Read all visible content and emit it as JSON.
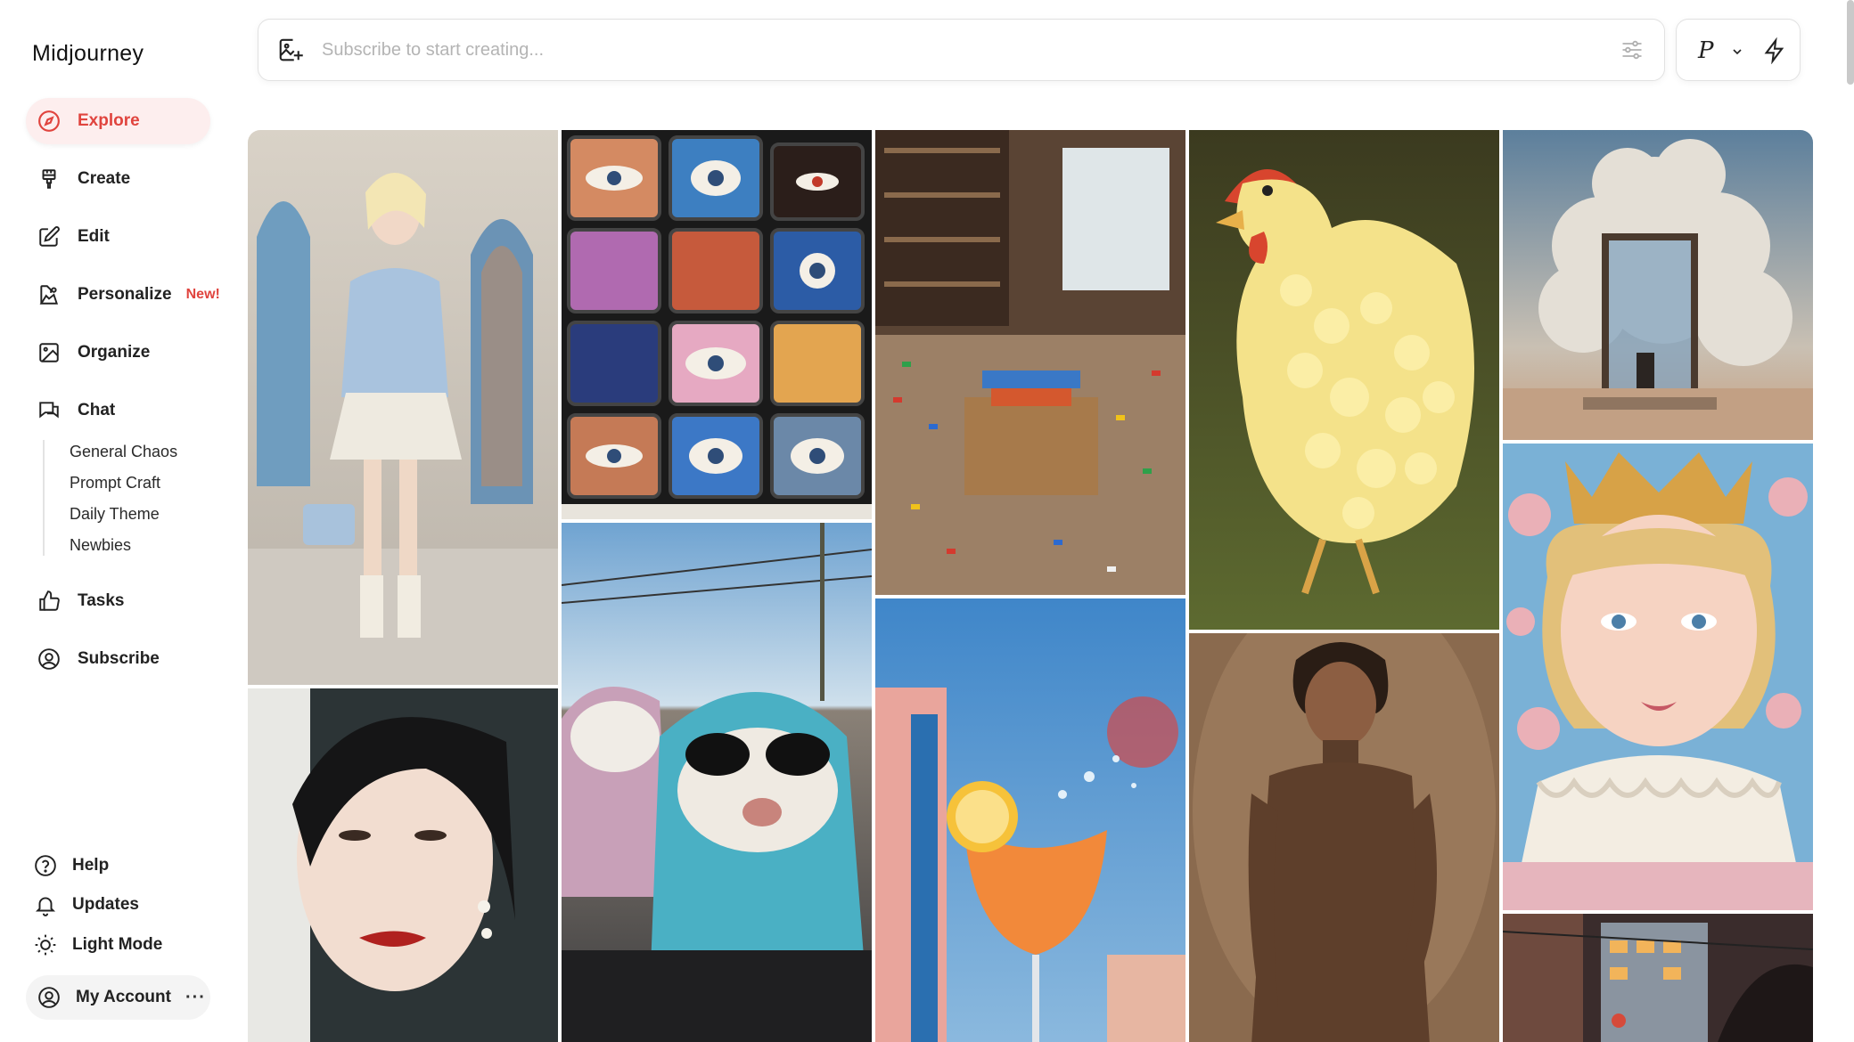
{
  "app": {
    "name": "Midjourney"
  },
  "nav": {
    "explore": "Explore",
    "create": "Create",
    "edit": "Edit",
    "personalize": "Personalize",
    "personalize_badge": "New!",
    "organize": "Organize",
    "chat": "Chat",
    "chat_channels": [
      "General Chaos",
      "Prompt Craft",
      "Daily Theme",
      "Newbies"
    ],
    "tasks": "Tasks",
    "subscribe": "Subscribe"
  },
  "footer_nav": {
    "help": "Help",
    "updates": "Updates",
    "light_mode": "Light Mode",
    "account": "My Account",
    "more": "···"
  },
  "prompt": {
    "placeholder": "Subscribe to start creating..."
  },
  "mode": {
    "letter": "P"
  },
  "colors": {
    "accent": "#e0443e",
    "active_bg": "#fdeeee"
  },
  "icons": [
    "compass-icon",
    "brush-icon",
    "edit-icon",
    "personalize-icon",
    "image-icon",
    "chat-icon",
    "thumbs-up-icon",
    "user-circle-icon",
    "help-icon",
    "bell-icon",
    "sun-icon",
    "image-add-icon",
    "sliders-icon",
    "chevron-down-icon",
    "bolt-icon"
  ],
  "gallery": {
    "items": [
      "girl-in-cathedral-pastel-outfit",
      "collage-of-retro-tv-eyes",
      "room-full-of-lego-bricks",
      "popcorn-chicken-sculpture",
      "door-frame-with-cloud",
      "woman-portrait-red-lips",
      "ferrets-with-sunglasses",
      "orange-cocktail-splash",
      "woman-in-brown-turtleneck",
      "girl-with-crown-illustration",
      "city-street-at-dusk"
    ]
  }
}
